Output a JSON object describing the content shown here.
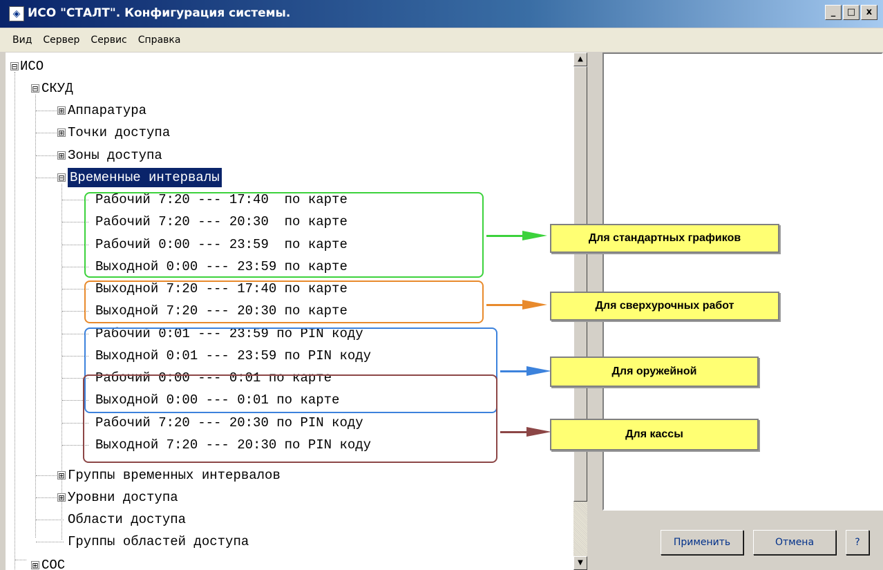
{
  "window": {
    "title": "ИСО \"СТАЛТ\". Конфигурация системы.",
    "controls": {
      "minimize": "_",
      "maximize": "□",
      "close": "x"
    }
  },
  "menu": [
    "Вид",
    "Сервер",
    "Сервис",
    "Справка"
  ],
  "tree": {
    "root": "ИСО",
    "skud": "СКУД",
    "hardware": "Аппаратура",
    "access_points": "Точки доступа",
    "access_zones": "Зоны доступа",
    "time_intervals": "Временные интервалы",
    "intervals": [
      "Рабочий 7:20 --- 17:40  по карте",
      "Рабочий 7:20 --- 20:30  по карте",
      "Рабочий 0:00 --- 23:59  по карте",
      "Выходной 0:00 --- 23:59 по карте",
      "Выходной 7:20 --- 17:40 по карте",
      "Выходной 7:20 --- 20:30 по карте",
      "Рабочий 0:01 --- 23:59 по PIN коду",
      "Выходной 0:01 --- 23:59 по PIN коду",
      "Рабочий 0:00 --- 0:01 по карте",
      "Выходной 0:00 --- 0:01 по карте",
      "Рабочий 7:20 --- 20:30 по PIN коду",
      "Выходной 7:20 --- 20:30 по PIN коду"
    ],
    "interval_groups": "Группы временных интервалов",
    "access_levels": "Уровни доступа",
    "access_areas": "Области доступа",
    "access_area_groups": "Группы областей доступа",
    "sos": "СОС"
  },
  "annotations": {
    "standard": {
      "label": "Для стандартных графиков",
      "color": "#3cd23c"
    },
    "overtime": {
      "label": "Для сверхурочных работ",
      "color": "#e88a2c"
    },
    "armory": {
      "label": "Для оружейной",
      "color": "#3c82dc"
    },
    "cashier": {
      "label": "Для кассы",
      "color": "#8c4646"
    }
  },
  "buttons": {
    "apply": "Применить",
    "cancel": "Отмена",
    "help": "?"
  },
  "scrollbar": {
    "up": "▲",
    "down": "▼"
  },
  "icons": {
    "expanded": "⊟",
    "collapsed": "⊞"
  }
}
